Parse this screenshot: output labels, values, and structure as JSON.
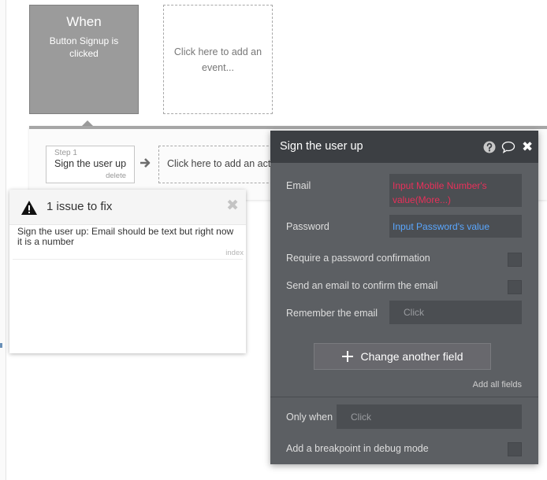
{
  "event": {
    "title": "When",
    "subtitle": "Button Signup is clicked"
  },
  "add_event_text": "Click here to add an event...",
  "step": {
    "number": "Step 1",
    "label": "Sign the user up",
    "delete_label": "delete"
  },
  "add_action_text": "Click here to add an action...",
  "issues": {
    "title": "1 issue to fix",
    "close_glyph": "✖",
    "items": [
      {
        "text": "Sign the user up: Email should be text but right now it is a number",
        "index_label": "index"
      }
    ]
  },
  "editor": {
    "title": "Sign the user up",
    "close_glyph": "✖",
    "email": {
      "label": "Email",
      "value": "Input Mobile Number's value(More...)"
    },
    "password": {
      "label": "Password",
      "value": "Input Password's value"
    },
    "require_confirmation": {
      "label": "Require a password confirmation",
      "checked": false
    },
    "send_email": {
      "label": "Send an email to confirm the email",
      "checked": false
    },
    "remember": {
      "label": "Remember the email",
      "placeholder": "Click"
    },
    "change_field_label": "Change another field",
    "add_all_label": "Add all fields",
    "only_when": {
      "label": "Only when",
      "placeholder": "Click"
    },
    "breakpoint": {
      "label": "Add a breakpoint in debug mode",
      "checked": false
    }
  },
  "icons": {
    "warning": "warning-triangle-icon",
    "help": "question-circle-icon",
    "comment": "comment-bubble-icon",
    "close": "close-icon",
    "arrow": "arrow-right-icon",
    "plus": "plus-icon"
  },
  "colors": {
    "event_block": "#9b9b9b",
    "editor_bg": "#5c5f63",
    "editor_header": "#3c3f43",
    "error_value": "#e8305a",
    "dynamic_value": "#5aa7ff"
  }
}
